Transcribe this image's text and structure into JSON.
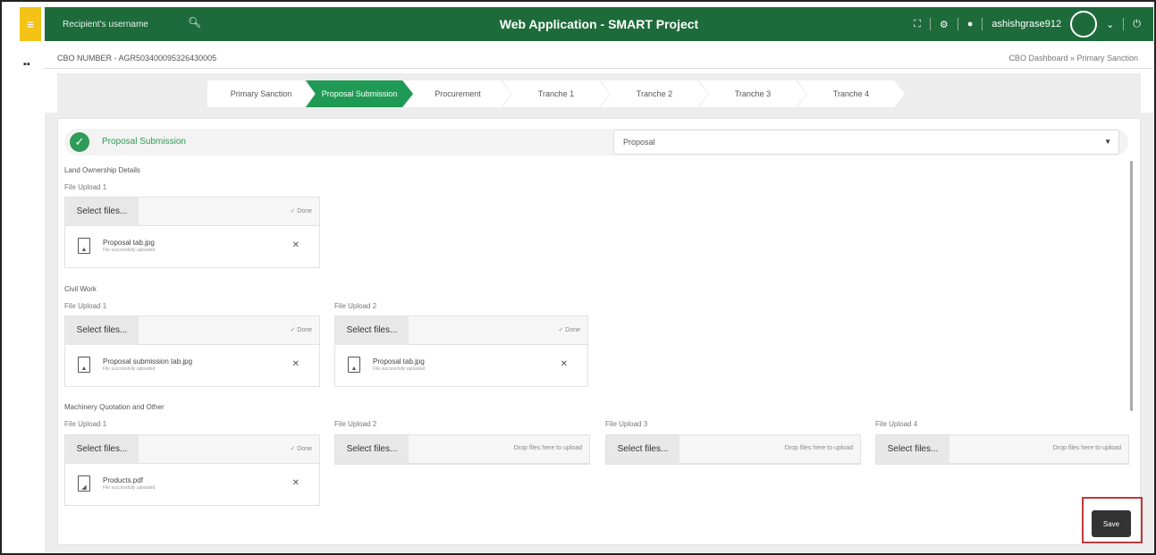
{
  "header": {
    "search_placeholder": "Recipient's username",
    "title": "Web Application - SMART Project",
    "username": "ashishgrase912"
  },
  "topbar": {
    "cbo_number": "CBO NUMBER - AGR503400095326430005",
    "breadcrumb": "CBO Dashboard  »  Primary Sanction"
  },
  "steps": [
    "Primary Sanction",
    "Proposal Submission",
    "Procurement",
    "Tranche 1",
    "Tranche 2",
    "Tranche 3",
    "Tranche 4"
  ],
  "active_step": "Proposal Submission",
  "section": {
    "title": "Proposal Submission",
    "select_value": "Proposal"
  },
  "groups": {
    "land": "Land Ownership Details",
    "civil": "Civil Work",
    "machinery": "Machinery Quotation and Other"
  },
  "uploads": {
    "select_label": "Select files...",
    "done_label": "✓ Done",
    "drop_label": "Drop files here to upload",
    "uploaded_sub": "File successfully uploaded",
    "fu1": "File Upload 1",
    "fu2": "File Upload 2",
    "fu3": "File Upload 3",
    "fu4": "File Upload 4",
    "land_file": "Proposal tab.jpg",
    "civil_file1": "Proposal submission tab.jpg",
    "civil_file2": "Proposal tab.jpg",
    "machinery_file1": "Products.pdf"
  },
  "actions": {
    "save": "Save"
  },
  "colors": {
    "header": "#1d6b3a",
    "accent": "#1f9a55",
    "hamburger": "#f3c318",
    "highlight": "#c0393b"
  }
}
